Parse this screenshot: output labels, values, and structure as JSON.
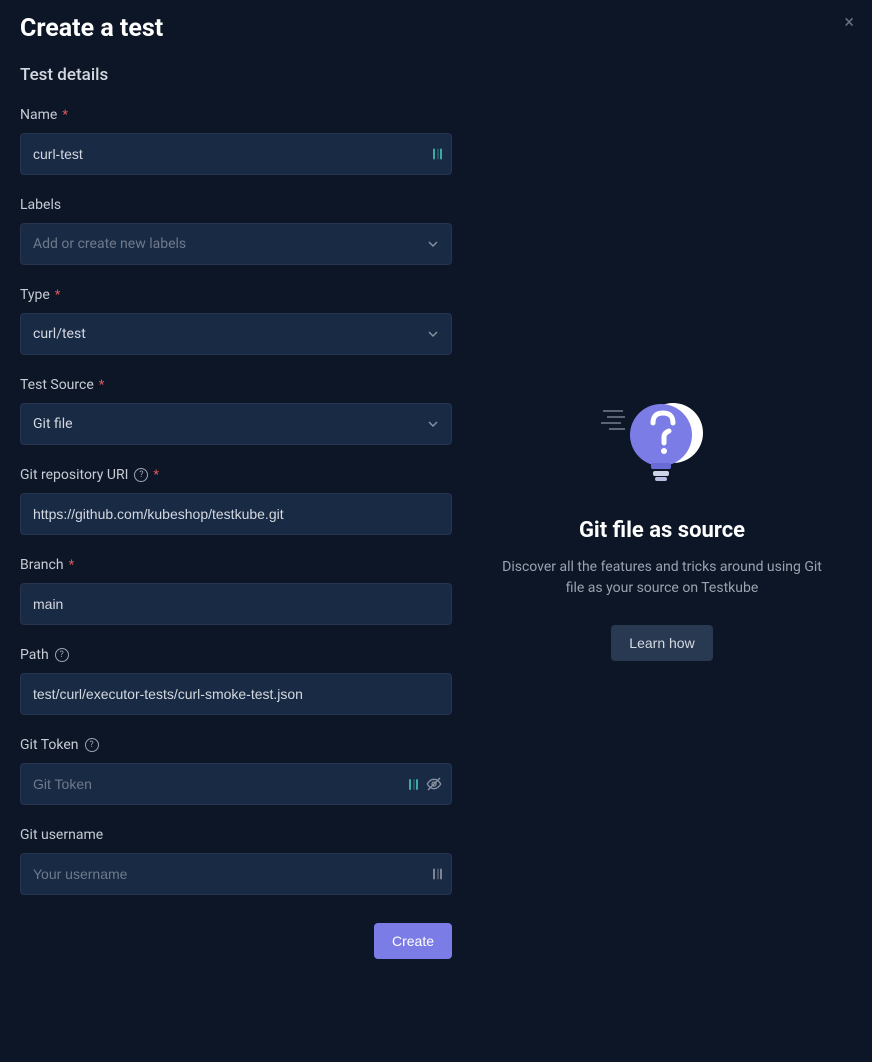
{
  "heading": "Create a test",
  "subheading": "Test details",
  "fields": {
    "name": {
      "label": "Name",
      "value": "curl-test"
    },
    "labels": {
      "label": "Labels",
      "placeholder": "Add or create new labels"
    },
    "type": {
      "label": "Type",
      "value": "curl/test"
    },
    "testSource": {
      "label": "Test Source",
      "value": "Git file"
    },
    "gitUri": {
      "label": "Git repository URI",
      "value": "https://github.com/kubeshop/testkube.git"
    },
    "branch": {
      "label": "Branch",
      "value": "main"
    },
    "path": {
      "label": "Path",
      "value": "test/curl/executor-tests/curl-smoke-test.json"
    },
    "gitToken": {
      "label": "Git Token",
      "placeholder": "Git Token"
    },
    "gitUsername": {
      "label": "Git username",
      "placeholder": "Your username"
    }
  },
  "actions": {
    "create": "Create"
  },
  "infoPanel": {
    "title": "Git file as source",
    "desc": "Discover all the features and tricks around using Git file as your source on Testkube",
    "cta": "Learn how"
  },
  "close": "×"
}
